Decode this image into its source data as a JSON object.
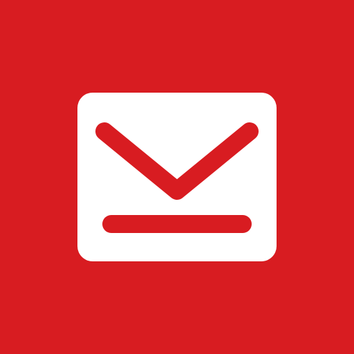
{
  "app_icon": {
    "name": "mail-icon",
    "background_color": "#d81c21",
    "glyph_color": "#ffffff",
    "accent_color": "#d81c21"
  }
}
